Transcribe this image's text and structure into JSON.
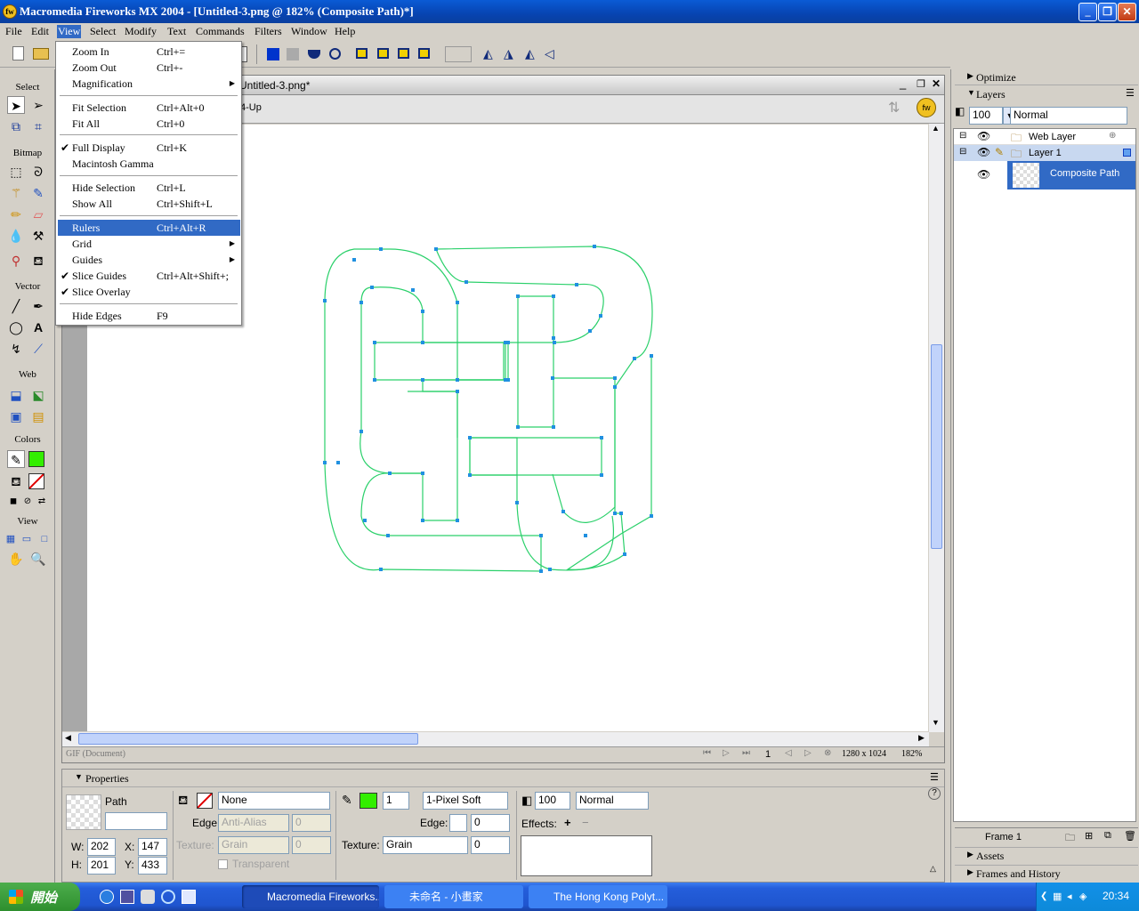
{
  "app": {
    "title": "Macromedia Fireworks MX 2004 - [Untitled-3.png @ 182% (Composite Path)*]",
    "logo": "fw"
  },
  "menubar": [
    "File",
    "Edit",
    "View",
    "Select",
    "Modify",
    "Text",
    "Commands",
    "Filters",
    "Window",
    "Help"
  ],
  "view_menu": {
    "items": [
      {
        "label": "Zoom In",
        "shortcut": "Ctrl+=",
        "checked": false,
        "submenu": false
      },
      {
        "label": "Zoom Out",
        "shortcut": "Ctrl+-",
        "checked": false,
        "submenu": false
      },
      {
        "label": "Magnification",
        "shortcut": "",
        "checked": false,
        "submenu": true
      },
      {
        "label": "Fit Selection",
        "shortcut": "Ctrl+Alt+0",
        "checked": false,
        "submenu": false
      },
      {
        "label": "Fit All",
        "shortcut": "Ctrl+0",
        "checked": false,
        "submenu": false
      },
      {
        "label": "Full Display",
        "shortcut": "Ctrl+K",
        "checked": true,
        "submenu": false
      },
      {
        "label": "Macintosh Gamma",
        "shortcut": "",
        "checked": false,
        "submenu": false
      },
      {
        "label": "Hide Selection",
        "shortcut": "Ctrl+L",
        "checked": false,
        "submenu": false
      },
      {
        "label": "Show All",
        "shortcut": "Ctrl+Shift+L",
        "checked": false,
        "submenu": false
      },
      {
        "label": "Rulers",
        "shortcut": "Ctrl+Alt+R",
        "checked": false,
        "submenu": false
      },
      {
        "label": "Grid",
        "shortcut": "",
        "checked": false,
        "submenu": true
      },
      {
        "label": "Guides",
        "shortcut": "",
        "checked": false,
        "submenu": true
      },
      {
        "label": "Slice Guides",
        "shortcut": "Ctrl+Alt+Shift+;",
        "checked": true,
        "submenu": false
      },
      {
        "label": "Slice Overlay",
        "shortcut": "",
        "checked": true,
        "submenu": false
      },
      {
        "label": "Hide Edges",
        "shortcut": "F9",
        "checked": false,
        "submenu": false
      }
    ],
    "highlighted": "Rulers"
  },
  "tools": {
    "sections": [
      "Select",
      "Bitmap",
      "Vector",
      "Web",
      "Colors",
      "View"
    ],
    "stroke_color": "#33ee00",
    "fill_color": "#33ee00"
  },
  "document": {
    "tab": "Untitled-3.png*",
    "view_mode": "4-Up",
    "status_left": "GIF (Document)",
    "frame": "1",
    "size": "1280 x 1024",
    "zoom": "182%"
  },
  "panels": {
    "optimize": "Optimize",
    "layers": "Layers",
    "opacity": "100",
    "blend": "Normal",
    "layer_rows": [
      "Web Layer",
      "Layer 1",
      "Composite Path"
    ],
    "frame": "Frame 1",
    "assets": "Assets",
    "frames_history": "Frames and History"
  },
  "properties": {
    "title": "Properties",
    "object": "Path",
    "w": "202",
    "h": "201",
    "x": "147",
    "y": "433",
    "fill": "None",
    "edge_label": "Edge:",
    "edge_fill": "Anti-Alias",
    "edge_fill_val": "0",
    "texture_label": "Texture:",
    "texture_fill": "Grain",
    "texture_fill_val": "0",
    "transparent": "Transparent",
    "stroke_size": "1",
    "stroke_type": "1-Pixel Soft",
    "stroke_edge": "0",
    "stroke_texture": "Grain",
    "stroke_texture_val": "0",
    "opacity": "100",
    "blend": "Normal",
    "effects": "Effects:",
    "w_label": "W:",
    "h_label": "H:",
    "x_label": "X:",
    "y_label": "Y:"
  },
  "taskbar": {
    "start": "開始",
    "tasks": [
      "Macromedia Fireworks...",
      "未命名 - 小畫家",
      "The Hong Kong Polyt..."
    ],
    "time": "20:34"
  }
}
